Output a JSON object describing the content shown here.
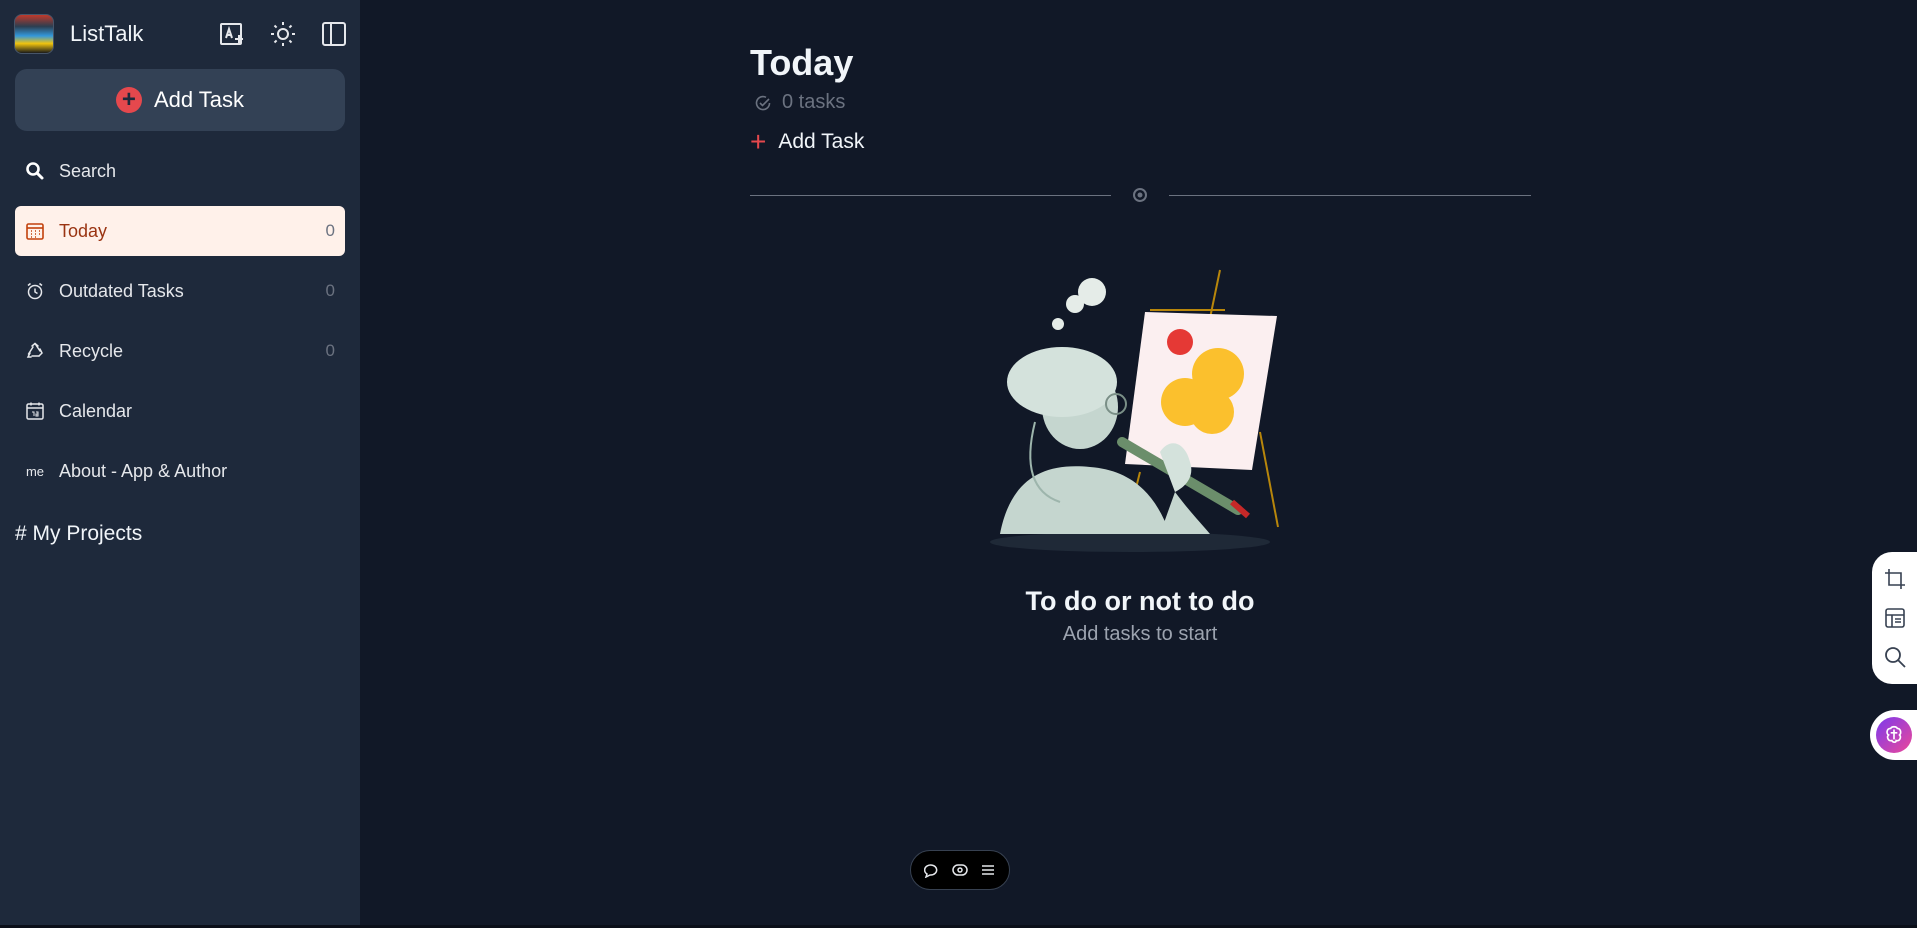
{
  "app": {
    "name": "ListTalk"
  },
  "header_icons": [
    "translate-icon",
    "sun-icon",
    "sidebar-toggle-icon"
  ],
  "sidebar": {
    "add_task_label": "Add Task",
    "items": [
      {
        "label": "Search",
        "icon": "search-icon"
      },
      {
        "label": "Today",
        "icon": "calendar-grid-icon",
        "count": "0",
        "active": true
      },
      {
        "label": "Outdated Tasks",
        "icon": "alarm-clock-icon",
        "count": "0"
      },
      {
        "label": "Recycle",
        "icon": "recycle-icon",
        "count": "0"
      },
      {
        "label": "Calendar",
        "icon": "calendar-icon"
      },
      {
        "label": "About - App & Author",
        "icon_text": "me"
      }
    ],
    "projects_label": "# My Projects"
  },
  "main": {
    "title": "Today",
    "task_count": "0 tasks",
    "add_task_label": "Add Task",
    "empty_title": "To do or not to do",
    "empty_subtitle": "Add tasks to start"
  },
  "colors": {
    "accent": "#e5484d",
    "sidebar_bg": "#1e293b",
    "main_bg": "#111827",
    "active_bg": "#fff1ea"
  }
}
